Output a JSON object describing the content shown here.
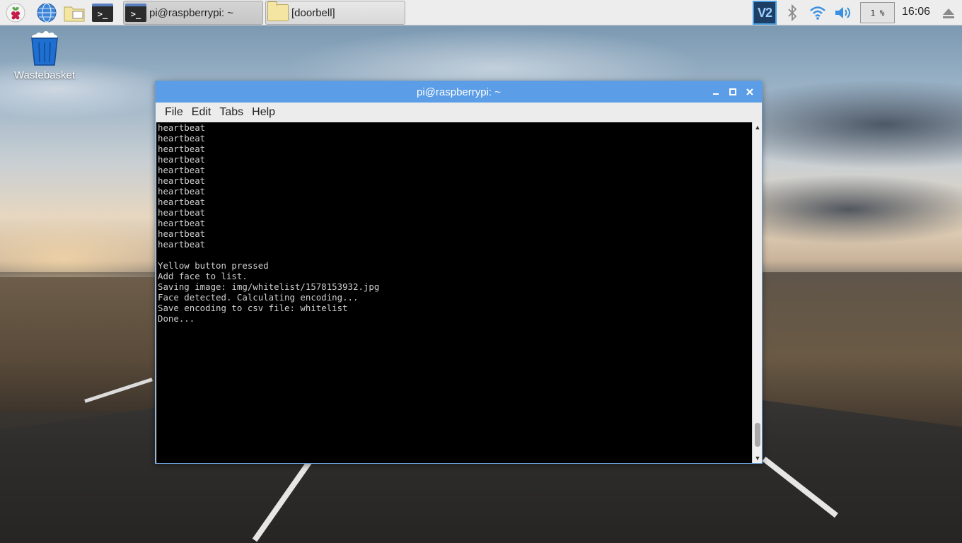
{
  "taskbar": {
    "launchers": [
      {
        "name": "raspberry-menu-icon"
      },
      {
        "name": "web-browser-icon"
      },
      {
        "name": "file-manager-icon"
      },
      {
        "name": "terminal-launcher-icon",
        "glyph": ">_"
      }
    ],
    "tasks": [
      {
        "label": "pi@raspberrypi: ~",
        "glyph": ">_",
        "active": true
      },
      {
        "label": "[doorbell]",
        "active": false
      }
    ],
    "tray": {
      "vnc_label": "V2",
      "cpu_usage": "1 %",
      "clock": "16:06"
    }
  },
  "desktop": {
    "icons": [
      {
        "label": "Wastebasket"
      }
    ]
  },
  "window": {
    "title": "pi@raspberrypi: ~",
    "menu": [
      "File",
      "Edit",
      "Tabs",
      "Help"
    ],
    "terminal_lines": [
      "heartbeat",
      "heartbeat",
      "heartbeat",
      "heartbeat",
      "heartbeat",
      "heartbeat",
      "heartbeat",
      "heartbeat",
      "heartbeat",
      "heartbeat",
      "heartbeat",
      "heartbeat",
      "",
      "Yellow button pressed",
      "Add face to list.",
      "Saving image: img/whitelist/1578153932.jpg",
      "Face detected. Calculating encoding...",
      "Save encoding to csv file: whitelist",
      "Done..."
    ]
  },
  "colors": {
    "titlebar": "#5b9de6",
    "terminal_bg": "#000000",
    "terminal_fg": "#cfcfcf",
    "vnc": "#1d3f66"
  }
}
